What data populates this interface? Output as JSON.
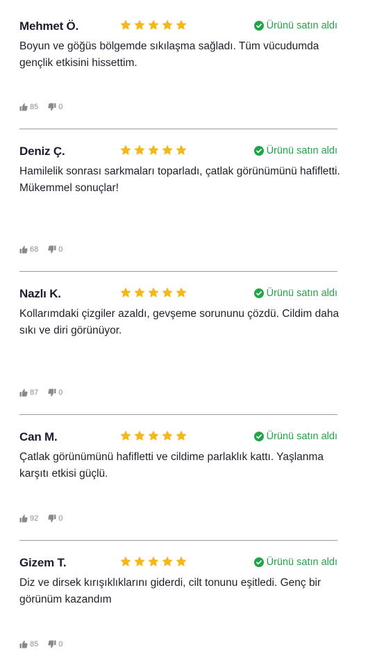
{
  "colors": {
    "star": "#F5B81C",
    "verified": "#22A449",
    "text": "#1F1F2B",
    "muted": "#8A8A8A",
    "divider": "#9A9A9A"
  },
  "reviews": [
    {
      "name": "Mehmet Ö.",
      "rating": 5,
      "verified_label": "Ürünü satın aldı",
      "text": "Boyun ve göğüs bölgemde sıkılaşma sağladı. Tüm vücudumda gençlik etkisini hissettim.",
      "likes": "85",
      "dislikes": "0"
    },
    {
      "name": "Deniz Ç.",
      "rating": 5,
      "verified_label": "Ürünü satın aldı",
      "text": "Hamilelik sonrası sarkmaları toparladı, çatlak görünümünü hafifletti. Mükemmel sonuçlar!",
      "likes": "68",
      "dislikes": "0"
    },
    {
      "name": "Nazlı K.",
      "rating": 5,
      "verified_label": "Ürünü satın aldı",
      "text": "Kollarımdaki çizgiler azaldı, gevşeme sorununu çözdü. Cildim daha sıkı ve diri görünüyor.",
      "likes": "87",
      "dislikes": "0"
    },
    {
      "name": "Can M.",
      "rating": 5,
      "verified_label": "Ürünü satın aldı",
      "text": "Çatlak görünümünü hafifletti ve cildime parlaklık kattı. Yaşlanma karşıtı etkisi güçlü.",
      "likes": "92",
      "dislikes": "0"
    },
    {
      "name": "Gizem T.",
      "rating": 5,
      "verified_label": "Ürünü satın aldı",
      "text": "Diz ve dirsek kırışıklıklarını giderdi, cilt tonunu eşitledi. Genç bir görünüm kazandım",
      "likes": "85",
      "dislikes": "0"
    }
  ]
}
